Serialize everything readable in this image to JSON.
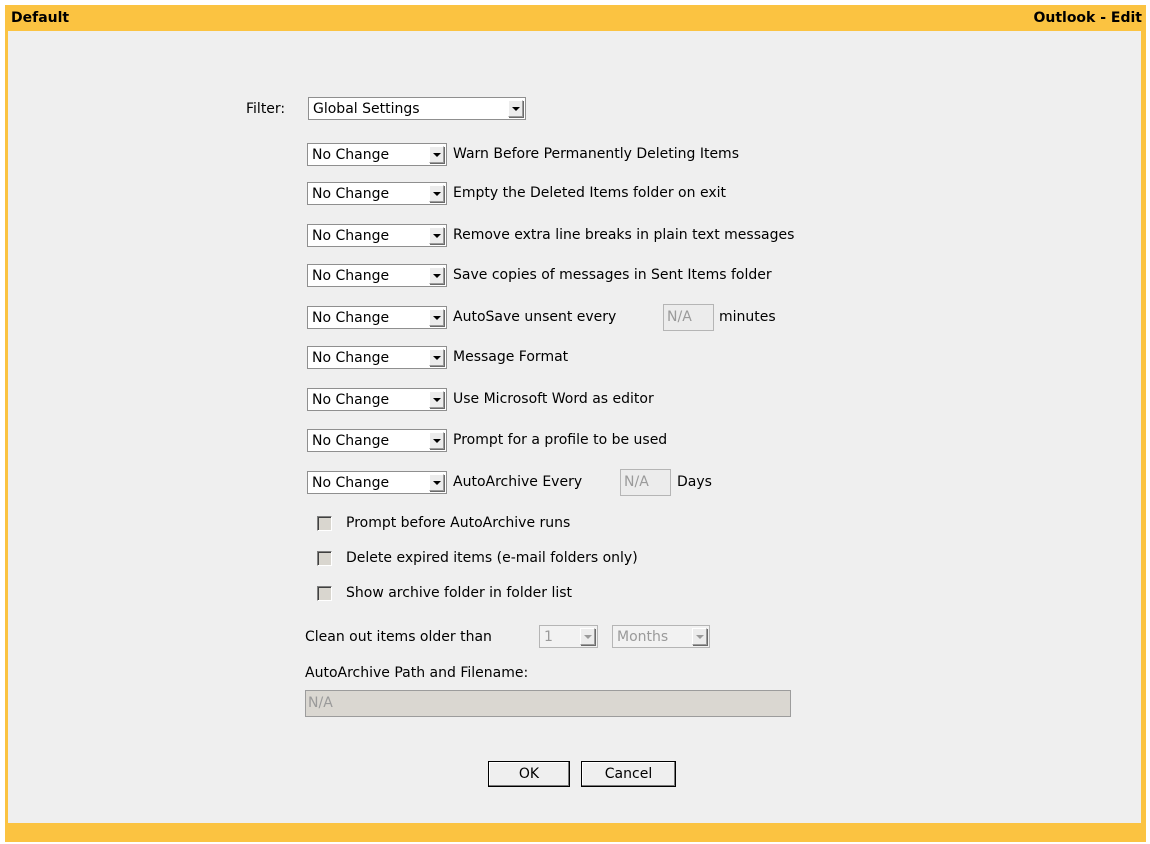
{
  "window": {
    "title_left": "Default",
    "title_right": "Outlook - Edit"
  },
  "filter": {
    "label": "Filter:",
    "value": "Global Settings"
  },
  "settings": [
    {
      "value": "No Change",
      "label": "Warn Before Permanently Deleting Items"
    },
    {
      "value": "No Change",
      "label": "Empty the Deleted Items folder on exit"
    },
    {
      "value": "No Change",
      "label": "Remove extra line breaks in plain text messages"
    },
    {
      "value": "No Change",
      "label": "Save copies of messages in Sent Items folder"
    },
    {
      "value": "No Change",
      "label": "AutoSave unsent every",
      "input_value": "N/A",
      "suffix": "minutes"
    },
    {
      "value": "No Change",
      "label": "Message Format"
    },
    {
      "value": "No Change",
      "label": "Use Microsoft Word as editor"
    },
    {
      "value": "No Change",
      "label": "Prompt for a profile to be used"
    },
    {
      "value": "No Change",
      "label": "AutoArchive Every",
      "input_value": "N/A",
      "suffix": "Days"
    }
  ],
  "checkboxes": [
    {
      "label": "Prompt before AutoArchive runs",
      "checked": false
    },
    {
      "label": "Delete expired items (e-mail folders only)",
      "checked": false
    },
    {
      "label": "Show archive folder in folder list",
      "checked": false
    }
  ],
  "cleanout": {
    "label": "Clean out items older than",
    "amount": "1",
    "unit": "Months"
  },
  "archive_path": {
    "label": "AutoArchive Path and Filename:",
    "value": "N/A"
  },
  "buttons": {
    "ok": "OK",
    "cancel": "Cancel"
  },
  "colors": {
    "frame": "#fbc341",
    "panel": "#efefef"
  }
}
